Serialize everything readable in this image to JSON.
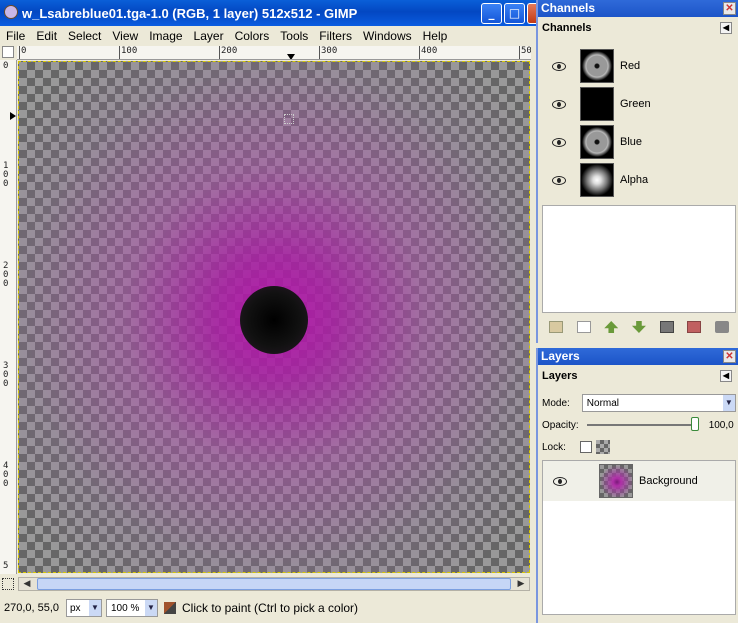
{
  "window": {
    "title": "w_Lsabreblue01.tga-1.0 (RGB, 1 layer) 512x512 - GIMP",
    "buttons": {
      "minimize": "_",
      "maximize": "□",
      "close": "✕"
    }
  },
  "menu": [
    "File",
    "Edit",
    "Select",
    "View",
    "Image",
    "Layer",
    "Colors",
    "Tools",
    "Filters",
    "Windows",
    "Help"
  ],
  "rulers": {
    "horizontal_labels": [
      "0",
      "100",
      "200",
      "300",
      "400",
      "50"
    ],
    "vertical_labels": [
      "0",
      "1\n0\n0",
      "2\n0\n0",
      "3\n0\n0",
      "4\n0\n0",
      "5"
    ]
  },
  "canvas": {
    "accent": "#b014a8"
  },
  "status": {
    "coords": "270,0, 55,0",
    "unit": "px",
    "zoom": "100 %",
    "message": "Click to paint (Ctrl to pick a color)"
  },
  "channels_dock": {
    "title": "Channels",
    "header": "Channels",
    "channels": [
      {
        "name": "Red"
      },
      {
        "name": "Green"
      },
      {
        "name": "Blue"
      },
      {
        "name": "Alpha"
      }
    ]
  },
  "layers_dock": {
    "title": "Layers",
    "header": "Layers",
    "mode_label": "Mode:",
    "mode_value": "Normal",
    "opacity_label": "Opacity:",
    "opacity_value": "100,0",
    "lock_label": "Lock:",
    "layers": [
      {
        "name": "Background"
      }
    ]
  }
}
